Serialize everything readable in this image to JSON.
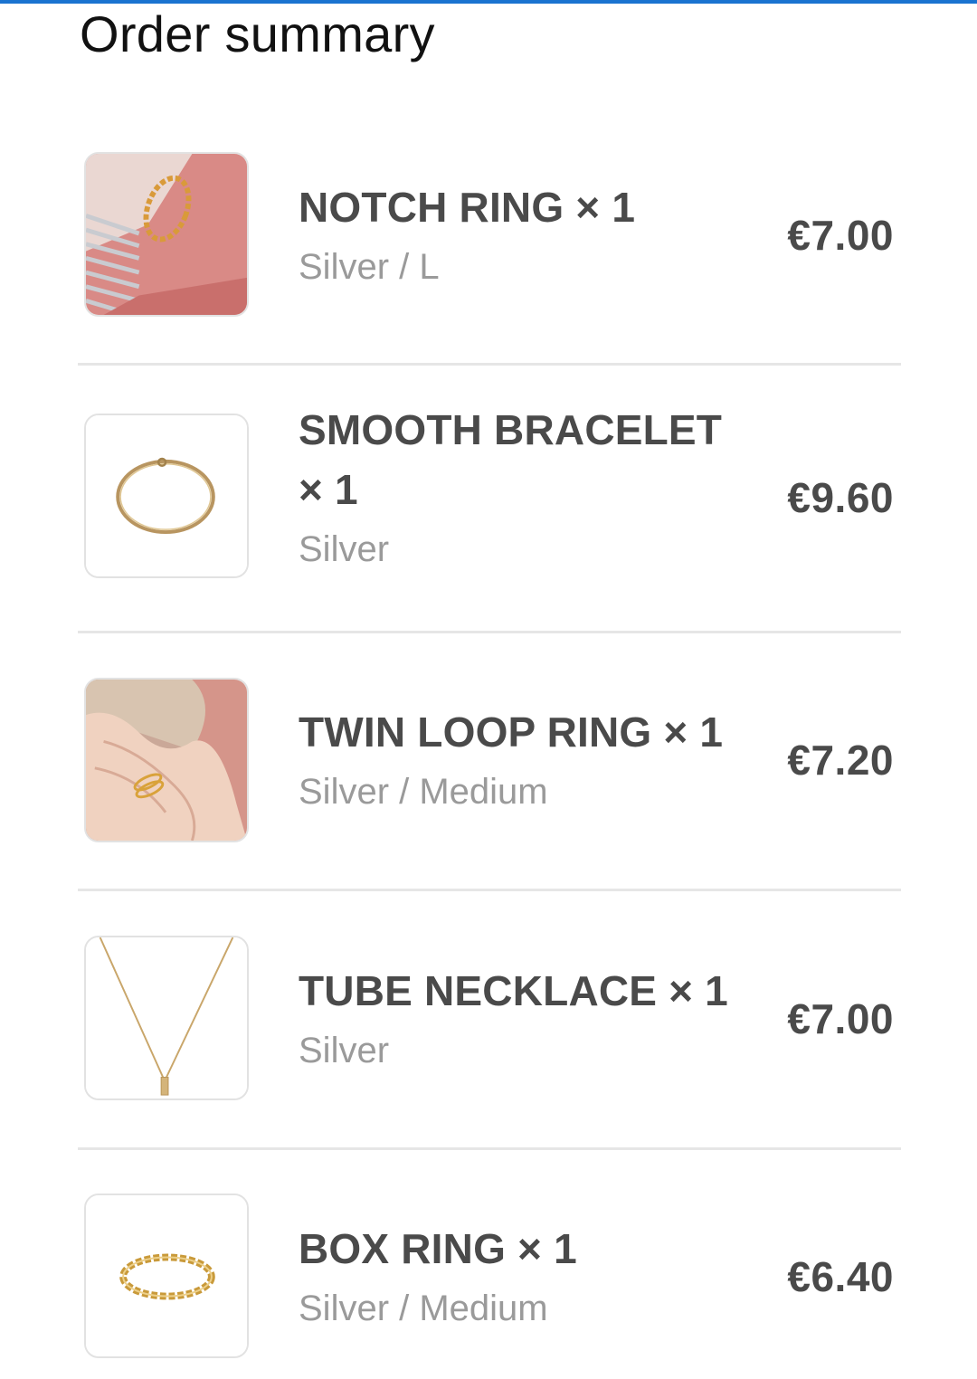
{
  "page": {
    "title": "Order summary"
  },
  "theme": {
    "accent": "#1a73d0",
    "text_primary": "#4a4a4a",
    "text_secondary": "#9a9a9a",
    "divider": "#e6e6e6"
  },
  "items": [
    {
      "name": "NOTCH RING × 1",
      "variant": "Silver / L",
      "price": "€7.00",
      "image_icon": "notch-ring-photo"
    },
    {
      "name": "SMOOTH BRACELET × 1",
      "variant": "Silver",
      "price": "€9.60",
      "image_icon": "smooth-bracelet-photo"
    },
    {
      "name": "TWIN LOOP RING × 1",
      "variant": "Silver / Medium",
      "price": "€7.20",
      "image_icon": "twin-loop-ring-photo"
    },
    {
      "name": "TUBE NECKLACE × 1",
      "variant": "Silver",
      "price": "€7.00",
      "image_icon": "tube-necklace-photo"
    },
    {
      "name": "BOX RING × 1",
      "variant": "Silver / Medium",
      "price": "€6.40",
      "image_icon": "box-ring-photo"
    }
  ]
}
